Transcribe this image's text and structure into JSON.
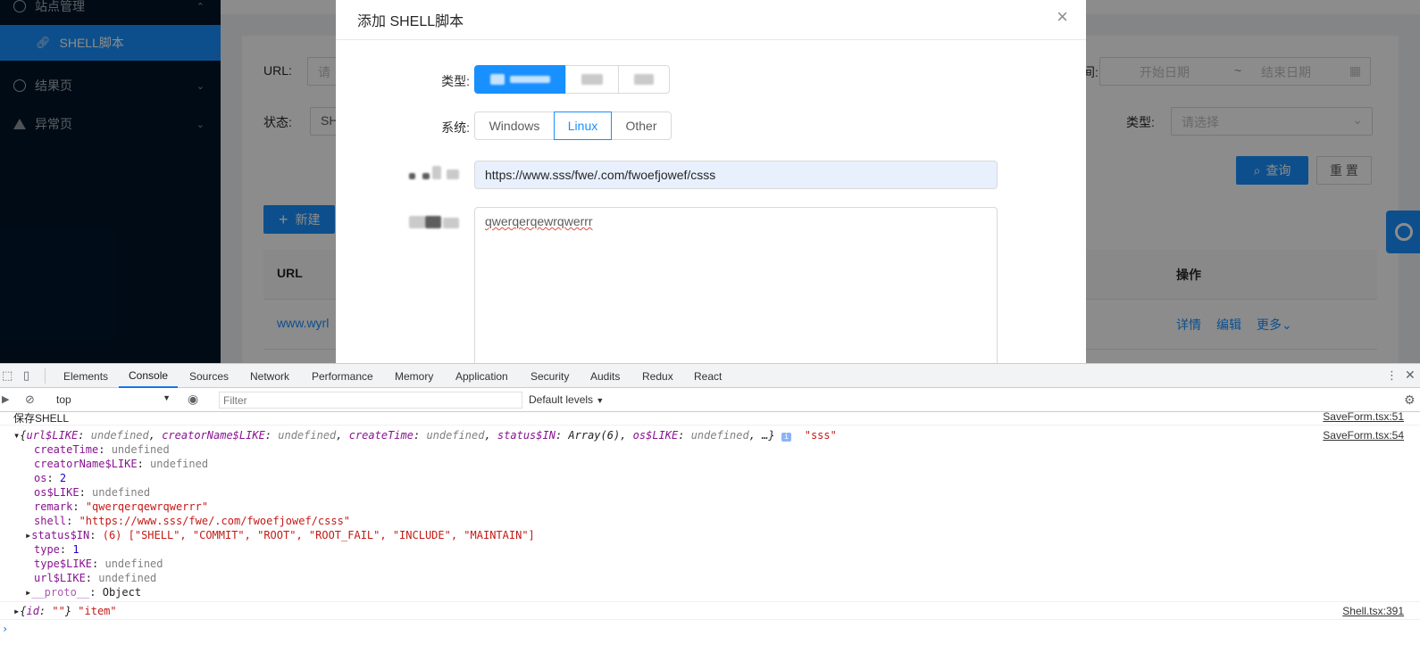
{
  "sidebar": {
    "top_item": "站点管理",
    "active_item": "SHELL脚本",
    "items": [
      {
        "label": "结果页"
      },
      {
        "label": "异常页"
      }
    ]
  },
  "search_form": {
    "url_label": "URL:",
    "url_placeholder": "请",
    "status_label": "状态:",
    "status_value": "SH",
    "type_label": "类型:",
    "type_placeholder": "请选择",
    "date_label": "间:",
    "date_start": "开始日期",
    "date_sep": "~",
    "date_end": "结束日期",
    "query_button": "查询",
    "reset_button": "重 置",
    "new_button": "新建"
  },
  "table": {
    "columns": [
      "URL",
      "操作"
    ],
    "row": {
      "url": "www.wyrl",
      "actions": [
        "详情",
        "编辑",
        "更多"
      ]
    }
  },
  "modal": {
    "title": "添加 SHELL脚本",
    "type_label": "类型:",
    "system_label": "系统:",
    "system_options": [
      "Windows",
      "Linux",
      "Other"
    ],
    "system_selected": "Linux",
    "url_value": "https://www.sss/fwe/.com/fwoefjowef/csss",
    "remark_value": "qwerqerqewrqwerrr"
  },
  "devtools": {
    "tabs": [
      "Elements",
      "Console",
      "Sources",
      "Network",
      "Performance",
      "Memory",
      "Application",
      "Security",
      "Audits",
      "Redux",
      "React"
    ],
    "active_tab": "Console",
    "context": "top",
    "filter_placeholder": "Filter",
    "levels": "Default levels",
    "console": {
      "line1_text": "保存SHELL",
      "line1_src": "SaveForm.tsx:51",
      "line2_src": "SaveForm.tsx:54",
      "line3_src": "Shell.tsx:391",
      "obj_summary_str": "\"sss\"",
      "props": [
        {
          "key": "createTime",
          "value": "undefined"
        },
        {
          "key": "creatorName$LIKE",
          "value": "undefined"
        },
        {
          "key": "os",
          "value": "2"
        },
        {
          "key": "os$LIKE",
          "value": "undefined"
        },
        {
          "key": "remark",
          "value": "\"qwerqerqewrqwerrr\""
        },
        {
          "key": "shell",
          "value": "\"https://www.sss/fwe/.com/fwoefjowef/csss\""
        },
        {
          "key": "status$IN",
          "value": "(6) [\"SHELL\", \"COMMIT\", \"ROOT\", \"ROOT_FAIL\", \"INCLUDE\", \"MAINTAIN\"]"
        },
        {
          "key": "type",
          "value": "1"
        },
        {
          "key": "type$LIKE",
          "value": "undefined"
        },
        {
          "key": "url$LIKE",
          "value": "undefined"
        },
        {
          "key": "__proto__",
          "value": "Object"
        }
      ],
      "item_log_value": "\"item\""
    }
  }
}
